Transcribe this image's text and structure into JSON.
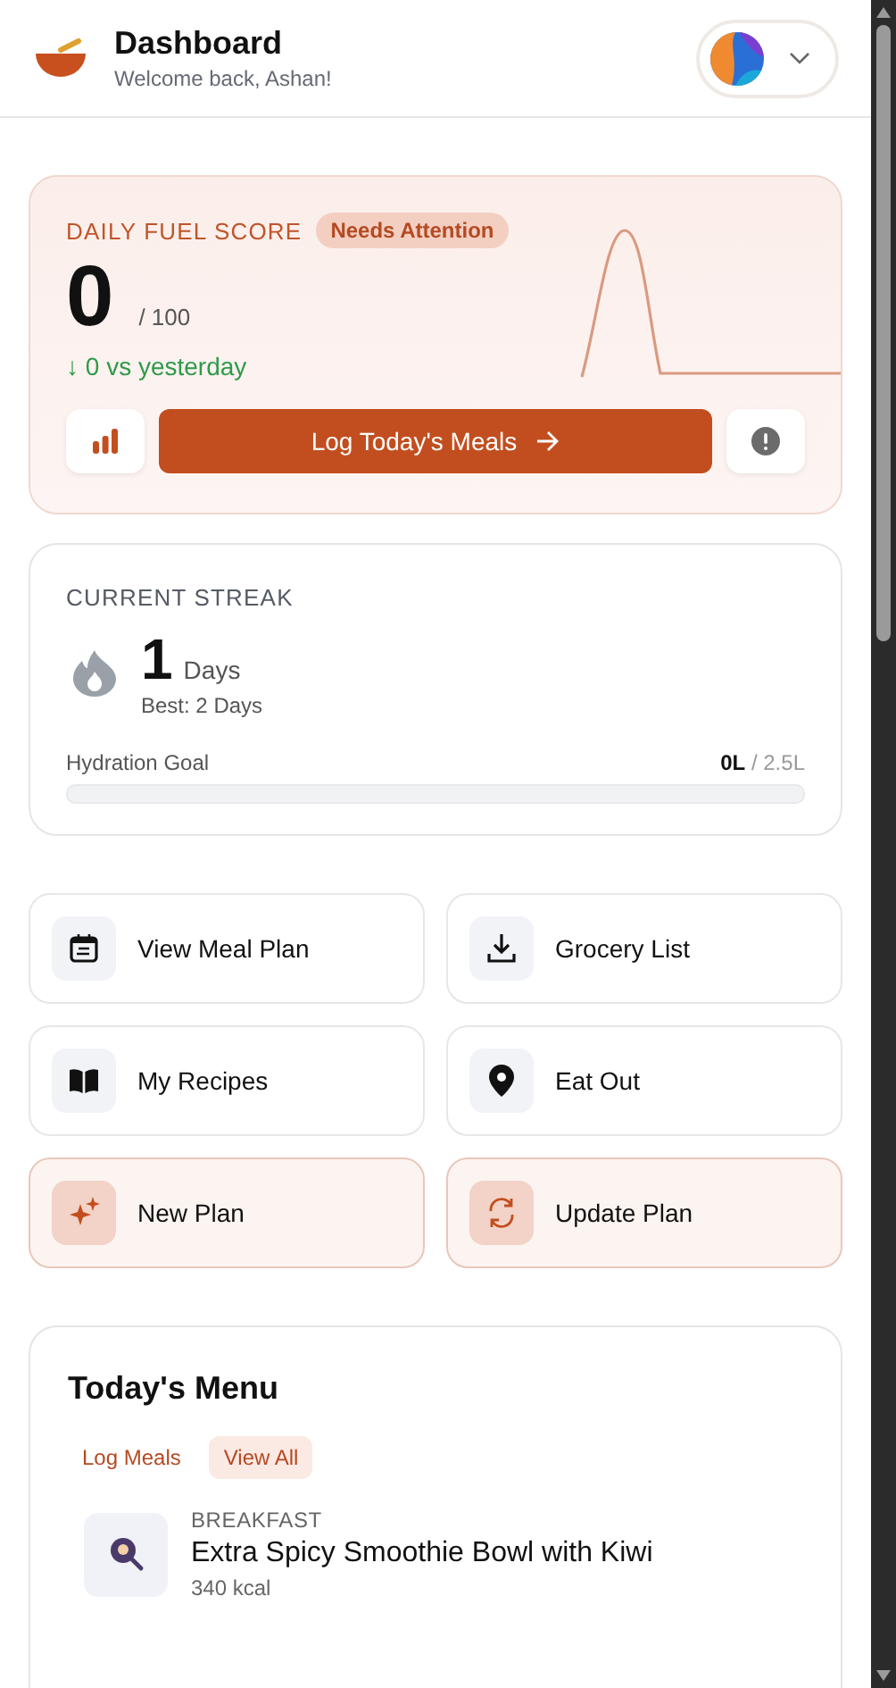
{
  "header": {
    "title": "Dashboard",
    "subtitle": "Welcome back, Ashan!"
  },
  "fuel_score": {
    "label": "DAILY FUEL SCORE",
    "badge": "Needs Attention",
    "score": "0",
    "max": "/ 100",
    "change": "↓ 0 vs yesterday",
    "primary_button": "Log Today's Meals"
  },
  "streak": {
    "label": "CURRENT STREAK",
    "count": "1",
    "unit": "Days",
    "best": "Best: 2 Days",
    "hydration": {
      "label": "Hydration Goal",
      "current": "0L",
      "goal": "/ 2.5L"
    }
  },
  "actions": [
    {
      "label": "View Meal Plan",
      "kind": "plain"
    },
    {
      "label": "Grocery List",
      "kind": "plain"
    },
    {
      "label": "My Recipes",
      "kind": "plain"
    },
    {
      "label": "Eat Out",
      "kind": "plain"
    },
    {
      "label": "New Plan",
      "kind": "accent"
    },
    {
      "label": "Update Plan",
      "kind": "accent"
    }
  ],
  "menu": {
    "title": "Today's Menu",
    "tabs": [
      {
        "label": "Log Meals",
        "selected": false
      },
      {
        "label": "View All",
        "selected": true
      }
    ],
    "meals": [
      {
        "type": "BREAKFAST",
        "name": "Extra Spicy Smoothie Bowl with Kiwi",
        "calories": "340 kcal"
      }
    ]
  }
}
